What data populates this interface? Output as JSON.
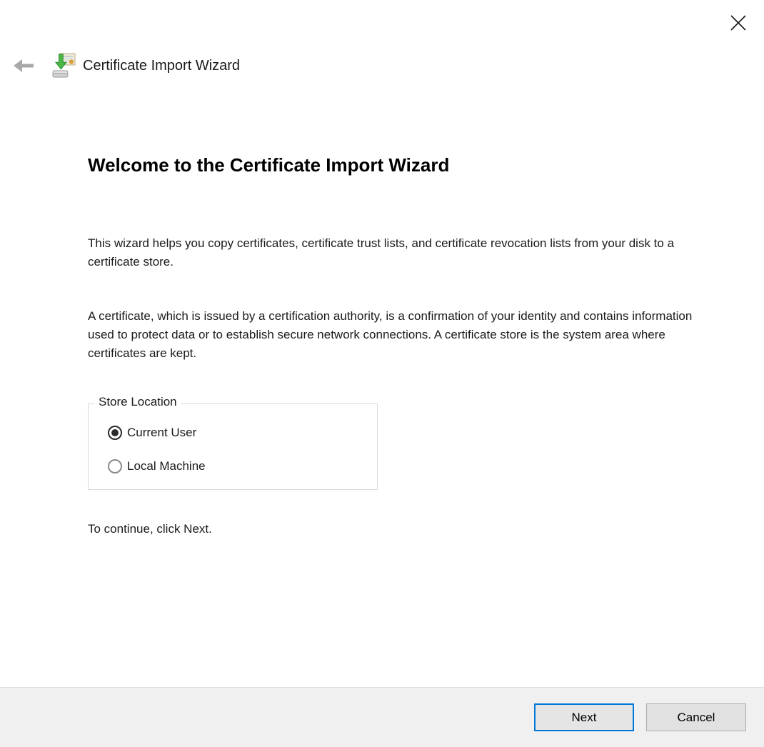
{
  "window": {
    "title": "Certificate Import Wizard"
  },
  "icons": {
    "close": "x-close",
    "back": "left-arrow",
    "wizard": "certificate-import"
  },
  "content": {
    "heading": "Welcome to the Certificate Import Wizard",
    "paragraph1": "This wizard helps you copy certificates, certificate trust lists, and certificate revocation lists from your disk to a certificate store.",
    "paragraph2": "A certificate, which is issued by a certification authority, is a confirmation of your identity and contains information used to protect data or to establish secure network connections. A certificate store is the system area where certificates are kept.",
    "store_location": {
      "label": "Store Location",
      "options": [
        {
          "label": "Current User",
          "selected": true
        },
        {
          "label": "Local Machine",
          "selected": false
        }
      ]
    },
    "hint": "To continue, click Next."
  },
  "buttons": {
    "next": "Next",
    "cancel": "Cancel"
  },
  "colors": {
    "accent": "#0078d7",
    "button_face": "#e1e1e1",
    "footer_background": "#f0f0f0",
    "divider": "#dfdfdf",
    "groupbox_border": "#d9d9d9"
  }
}
